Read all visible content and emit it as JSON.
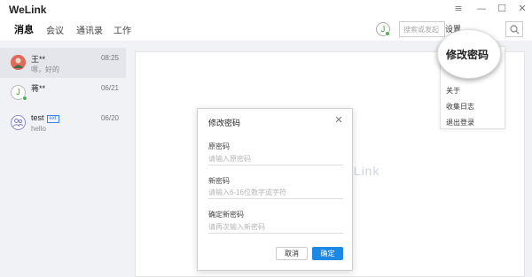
{
  "window": {
    "title": "WeLink",
    "controls": [
      "≡",
      "—",
      "☐",
      "✕"
    ]
  },
  "nav": {
    "tabs": [
      "消息",
      "会议",
      "通讯录",
      "工作"
    ],
    "active_tab": 0,
    "user_avatar_initial": "J",
    "search_placeholder": "搜索或发起",
    "settings_label": "设置"
  },
  "conversations": [
    {
      "name": "王**",
      "preview": "嗯，好的",
      "time": "08:25",
      "avatar_color": "#e06a5c"
    },
    {
      "name": "蒋**",
      "preview": "",
      "time": "06/21",
      "avatar_initial": "J",
      "online": true
    },
    {
      "name": "test",
      "badge": "ext",
      "preview": "hello",
      "time": "06/20"
    }
  ],
  "background_logo": "eLink",
  "settings_menu": {
    "highlighted": "修改密码",
    "items": [
      "关于",
      "收集日志",
      "退出登录"
    ]
  },
  "dialog": {
    "title": "修改密码",
    "fields": [
      {
        "label": "原密码",
        "placeholder": "请输入原密码",
        "value": ""
      },
      {
        "label": "新密码",
        "placeholder": "请输入6-16位数字或字符",
        "value": ""
      },
      {
        "label": "确定新密码",
        "placeholder": "请再次输入新密码",
        "value": ""
      }
    ],
    "cancel_label": "取消",
    "ok_label": "确定"
  },
  "colors": {
    "accent": "#1e88e5",
    "online": "#4caf50",
    "sidebar_bg": "#f1f2f5"
  },
  "icons": {
    "search": "search-icon",
    "close": "close-icon",
    "menu": "menu-icon"
  }
}
